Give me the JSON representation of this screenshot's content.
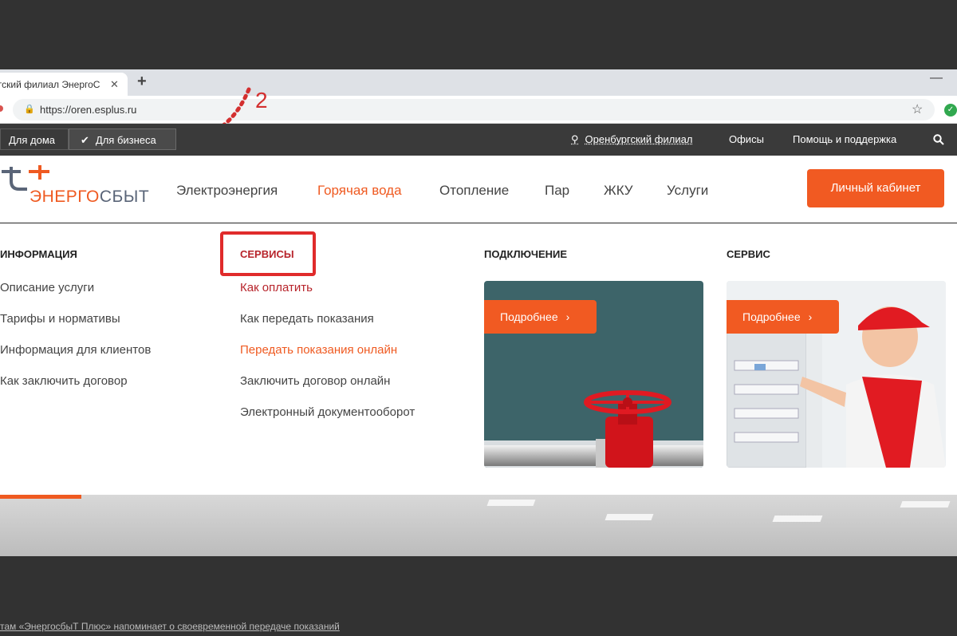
{
  "browser": {
    "tab_title": "гский филиал ЭнергоС",
    "tab_close": "✕",
    "new_tab": "+",
    "minimize": "—",
    "url": "https://oren.esplus.ru",
    "lock_icon": "🔒",
    "star_icon": "☆"
  },
  "annotation": {
    "label": "2",
    "color": "#d32f2f"
  },
  "topbar": {
    "home_label": "Для дома",
    "business_label": "Для бизнеса",
    "region": "Оренбургский филиал",
    "offices": "Офисы",
    "help": "Помощь и поддержка"
  },
  "header": {
    "logo": {
      "part1": "ЭНЕРГО",
      "part2": "СБЫТ"
    },
    "nav": [
      {
        "label": "Электроэнергия"
      },
      {
        "label": "Горячая вода"
      },
      {
        "label": "Отопление"
      },
      {
        "label": "Пар"
      },
      {
        "label": "ЖКУ"
      },
      {
        "label": "Услуги"
      }
    ],
    "cabinet_button": "Личный кабинет"
  },
  "mega_menu": {
    "info": {
      "title": "ИНФОРМАЦИЯ",
      "links": [
        "Описание услуги",
        "Тарифы и нормативы",
        "Информация для клиентов",
        "Как заключить договор"
      ]
    },
    "services": {
      "title": "СЕРВИСЫ",
      "links": [
        "Как оплатить",
        "Как передать показания",
        "Передать показания онлайн",
        "Заключить договор онлайн",
        "Электронный документооборот"
      ]
    },
    "connection": {
      "title": "ПОДКЛЮЧЕНИЕ",
      "button": "Подробнее"
    },
    "service": {
      "title": "СЕРВИС",
      "button": "Подробнее"
    }
  },
  "footer_caption": "там «ЭнергосбыТ Плюс» напоминает о своевременной передаче показаний",
  "colors": {
    "accent": "#f15a22",
    "highlight_box": "#e02b2b",
    "topbar": "#3a3a3a"
  }
}
